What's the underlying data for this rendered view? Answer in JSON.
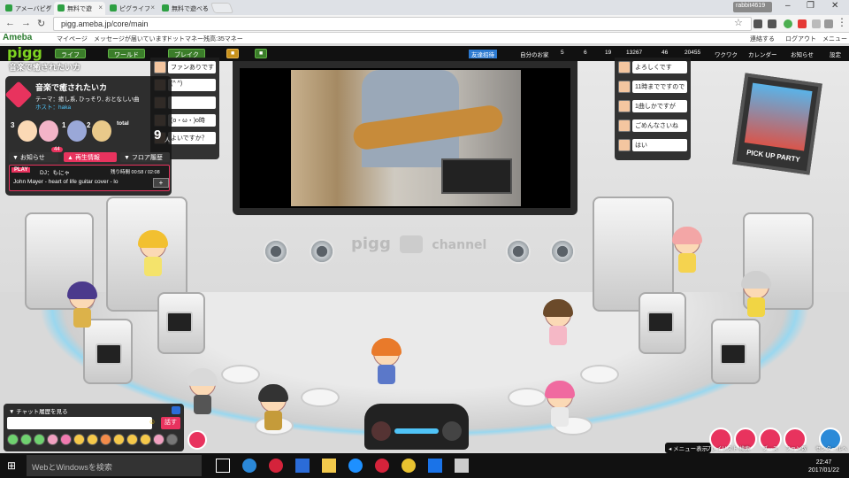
{
  "browser": {
    "tabs": [
      {
        "title": "アメーバピグ"
      },
      {
        "title": "無料で遊"
      },
      {
        "title": "ピグライフ"
      },
      {
        "title": "無料で遊べる"
      }
    ],
    "user_badge": "rabbit4619",
    "url": "pigg.ameba.jp/core/main"
  },
  "ameba_bar": {
    "logo": "Ameba",
    "mypage": "マイページ",
    "message": "メッセージが届いています",
    "dotmoney": "ドットマネー残高:35マネー",
    "follow": "連絡する",
    "logout": "ログアウト",
    "menu": "メニュー"
  },
  "pigg_nav": {
    "logo": "pigg",
    "buttons": [
      "ライフ",
      "ワールド",
      "ブレイク"
    ],
    "friend_invite": "友達招待",
    "my_home": "自分のお家",
    "stats": [
      "5",
      "6",
      "19",
      "13267",
      "46",
      "20455"
    ],
    "wakuwaku": "ワクワク",
    "calendar": "カレンダー",
    "notice": "お知らせ",
    "settings": "設定"
  },
  "room": {
    "title_label": "音楽で癒されたいカ",
    "name": "音楽で癒されたいカ",
    "theme": "テーマ：癒し系, ひっそり, おとなしい曲",
    "host": "ホスト：haka",
    "counts": [
      "3",
      "1",
      "2"
    ],
    "total_label": "total",
    "total_value": "9",
    "total_unit": "人",
    "tab_notice": "お知らせ",
    "tab_notice_badge": "44",
    "tab_playing": "再生情報",
    "tab_history": "フロア履歴",
    "play_badge": "PLAY",
    "dj_label": "DJ：もにゃ",
    "remaining": "残り時間 00:58 / 02:08",
    "track": "John Mayer - heart of life guitar cover - lo",
    "add_btn": "+"
  },
  "left_chat": [
    {
      "text": "ファンありです"
    },
    {
      "text": "(^ ^)"
    },
    {
      "text": ""
    },
    {
      "text": "(o・ω・)o時"
    },
    {
      "text": "よいですか？"
    }
  ],
  "right_chat": [
    {
      "text": "よろしくです"
    },
    {
      "text": "11時までですので"
    },
    {
      "text": "1曲しかですが"
    },
    {
      "text": "ごめんなさいね"
    },
    {
      "text": "はい"
    }
  ],
  "stage": {
    "brand": "pigg",
    "channel": "channel",
    "pickup": "PICK UP PARTY"
  },
  "chatbar": {
    "history": "チャット履歴を見る",
    "send": "話す"
  },
  "right_buttons": [
    {
      "label": "プレイリスト",
      "color": "#e8335e"
    },
    {
      "label": "検索",
      "color": "#e8335e"
    },
    {
      "label": "ブース",
      "color": "#e8335e"
    },
    {
      "label": "ファン数",
      "color": "#e8335e"
    },
    {
      "label": "センタールへ",
      "color": "#2b8ad8"
    }
  ],
  "menu_show": "メニュー表示",
  "taskbar": {
    "search": "WebとWindowsを検索",
    "time": "22:47",
    "date": "2017/01/22"
  }
}
